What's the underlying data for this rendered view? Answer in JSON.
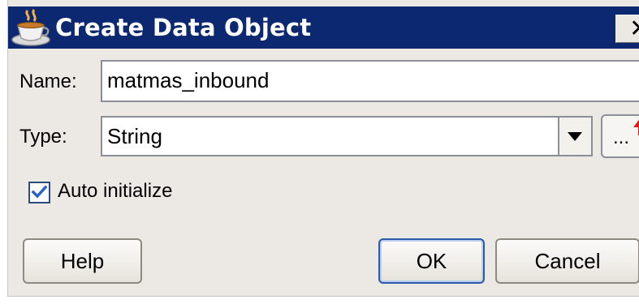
{
  "window": {
    "title": "Create Data Object",
    "close_glyph": "✕"
  },
  "form": {
    "name_label": "Name:",
    "name_value": "matmas_inbound",
    "type_label": "Type:",
    "type_value": "String",
    "browse_label": "...",
    "auto_initialize_label": "Auto initialize",
    "auto_initialize_checked": true
  },
  "buttons": {
    "help": "Help",
    "ok": "OK",
    "cancel": "Cancel"
  },
  "colors": {
    "titlebar": "#0b2870",
    "dialog_bg": "#ece9e4",
    "check": "#2a62c9"
  },
  "icons": {
    "app": "coffee-cup-icon",
    "close": "close-icon",
    "dropdown": "chevron-down-icon",
    "browse_badge": "red-arrow-icon",
    "check": "checkmark-icon"
  }
}
